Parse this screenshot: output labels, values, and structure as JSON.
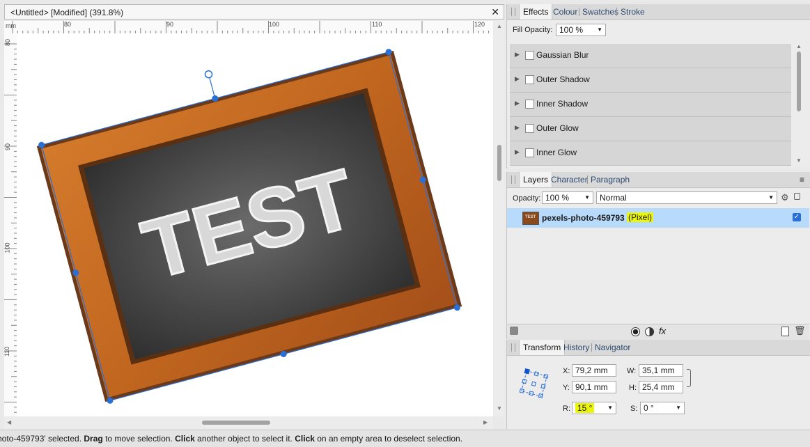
{
  "document": {
    "title": "<Untitled> [Modified] (391.8%)",
    "close": "✕"
  },
  "ruler": {
    "unit": "mm",
    "top_labels": [
      "80",
      "90",
      "100",
      "110",
      "120"
    ],
    "left_labels": [
      "80",
      "90",
      "100",
      "110"
    ]
  },
  "effects_panel": {
    "tabs": [
      "Effects",
      "Colour",
      "Swatches",
      "Stroke"
    ],
    "fill_opacity_label": "Fill Opacity:",
    "fill_opacity_value": "100 %",
    "items": [
      "Gaussian Blur",
      "Outer Shadow",
      "Inner Shadow",
      "Outer Glow",
      "Inner Glow"
    ]
  },
  "layers_panel": {
    "tabs": [
      "Layers",
      "Character",
      "Paragraph"
    ],
    "opacity_label": "Opacity:",
    "opacity_value": "100 %",
    "blend_mode": "Normal",
    "layer_name": "pexels-photo-459793",
    "layer_type": "(Pixel)",
    "thumbnail_text": "TEST",
    "fx_label": "fx"
  },
  "transform_panel": {
    "tabs": [
      "Transform",
      "History",
      "Navigator"
    ],
    "x_label": "X:",
    "x_value": "79,2 mm",
    "y_label": "Y:",
    "y_value": "90,1 mm",
    "w_label": "W:",
    "w_value": "35,1 mm",
    "h_label": "H:",
    "h_value": "25,4 mm",
    "r_label": "R:",
    "r_value": "15 °",
    "s_label": "S:",
    "s_value": "0 °"
  },
  "canvas_image": {
    "text": "TEST"
  },
  "status": {
    "part1": "hoto-459793' selected. ",
    "bold1": "Drag",
    "part2": " to move selection. ",
    "bold2": "Click",
    "part3": " another object to select it. ",
    "bold3": "Click",
    "part4": " on an empty area to deselect selection."
  },
  "colors": {
    "selection": "#2a6fd6",
    "layer_highlight": "#b9dbfb",
    "annotation_highlight": "#eaf50a"
  }
}
